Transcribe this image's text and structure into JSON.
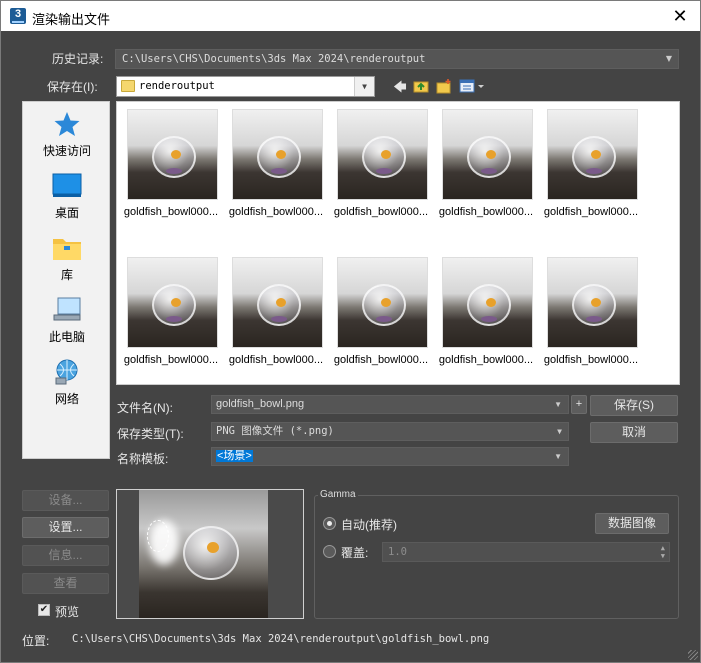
{
  "window": {
    "title": "渲染输出文件",
    "app_icon_text": "3",
    "close_glyph": "✕"
  },
  "history": {
    "label": "历史记录:",
    "value": "C:\\Users\\CHS\\Documents\\3ds Max 2024\\renderoutput"
  },
  "save_in": {
    "label": "保存在(I):",
    "value": "renderoutput"
  },
  "places": [
    {
      "label": "快速访问",
      "icon": "star-icon"
    },
    {
      "label": "桌面",
      "icon": "desktop-icon"
    },
    {
      "label": "库",
      "icon": "library-folder-icon"
    },
    {
      "label": "此电脑",
      "icon": "computer-icon"
    },
    {
      "label": "网络",
      "icon": "network-icon"
    }
  ],
  "files": [
    {
      "name": "goldfish_bowl000..."
    },
    {
      "name": "goldfish_bowl000..."
    },
    {
      "name": "goldfish_bowl000..."
    },
    {
      "name": "goldfish_bowl000..."
    },
    {
      "name": "goldfish_bowl000..."
    },
    {
      "name": "goldfish_bowl000..."
    },
    {
      "name": "goldfish_bowl000..."
    },
    {
      "name": "goldfish_bowl000..."
    },
    {
      "name": "goldfish_bowl000..."
    },
    {
      "name": "goldfish_bowl000..."
    }
  ],
  "form": {
    "filename_label": "文件名(N):",
    "filename_value": "goldfish_bowl.png",
    "filetype_label": "保存类型(T):",
    "filetype_value": "PNG 图像文件 (*.png)",
    "template_label": "名称模板:",
    "template_value": "<场景>",
    "plus_label": "+",
    "save_button": "保存(S)",
    "cancel_button": "取消"
  },
  "left_buttons": {
    "setup_disabled": "设备...",
    "setup": "设置...",
    "info": "信息...",
    "view": "查看",
    "preview_checkbox": "预览",
    "preview_checked": true
  },
  "gamma": {
    "title": "Gamma",
    "auto_label": "自动(推荐)",
    "data_image_button": "数据图像",
    "override_label": "覆盖:",
    "override_value": "1.0",
    "selected": "auto"
  },
  "location": {
    "label": "位置:",
    "value": "C:\\Users\\CHS\\Documents\\3ds Max 2024\\renderoutput\\goldfish_bowl.png"
  }
}
